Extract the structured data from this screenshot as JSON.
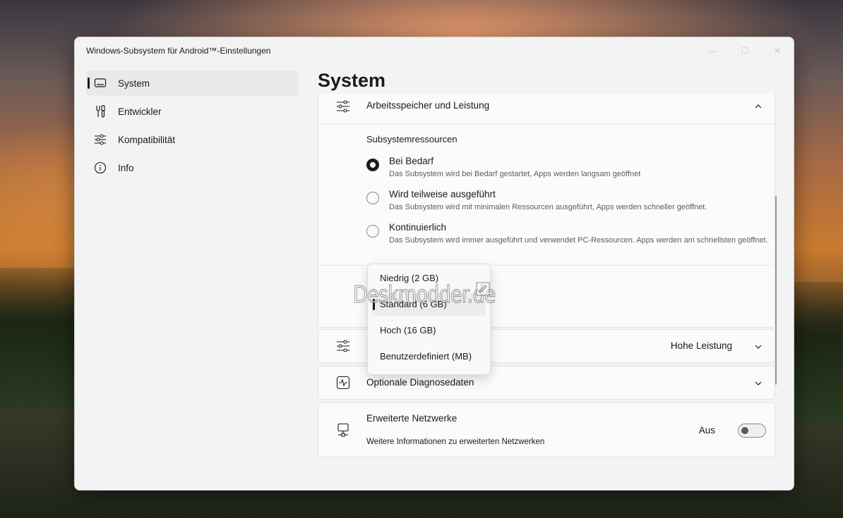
{
  "window": {
    "title": "Windows-Subsystem für Android™-Einstellungen",
    "controls": {
      "minimize": "—",
      "maximize": "☐",
      "close": "✕"
    }
  },
  "sidebar": {
    "items": [
      {
        "label": "System",
        "icon": "laptop-icon",
        "active": true
      },
      {
        "label": "Entwickler",
        "icon": "developer-tools-icon",
        "active": false
      },
      {
        "label": "Kompatibilität",
        "icon": "sliders-icon",
        "active": false
      },
      {
        "label": "Info",
        "icon": "info-icon",
        "active": false
      }
    ]
  },
  "page": {
    "title": "System"
  },
  "memory_card": {
    "header": "Arbeitsspeicher und Leistung",
    "subtitle": "Subsystemressourcen",
    "options": [
      {
        "title": "Bei Bedarf",
        "desc": "Das Subsystem wird bei Bedarf gestartet, Apps werden langsam geöffnet",
        "selected": true
      },
      {
        "title": "Wird teilweise ausgeführt",
        "desc": "Das Subsystem wird mit minimalen Ressourcen ausgeführt, Apps werden schneller geöffnet.",
        "selected": false
      },
      {
        "title": "Kontinuierlich",
        "desc": "Das Subsystem wird immer ausgeführt und verwendet PC-Ressourcen. Apps werden am schnellsten geöffnet.",
        "selected": false
      }
    ]
  },
  "memory_dropdown": {
    "options": [
      "Niedrig (2 GB)",
      "Standard (6 GB)",
      "Hoch (16 GB)",
      "Benutzerdefiniert (MB)"
    ],
    "selected_index": 1
  },
  "graphics_card": {
    "value": "Hohe Leistung"
  },
  "diagnostics_card": {
    "label": "Optionale Diagnosedaten"
  },
  "network_card": {
    "label": "Erweiterte Netzwerke",
    "desc": "Weitere Informationen zu erweiterten Netzwerken",
    "toggle_label": "Aus",
    "toggle_on": false
  },
  "watermark": "Deskmodder.de",
  "colors": {
    "accent": "#1b1b1b",
    "window_bg": "#f3f3f3",
    "card_bg": "#fbfbfb"
  }
}
